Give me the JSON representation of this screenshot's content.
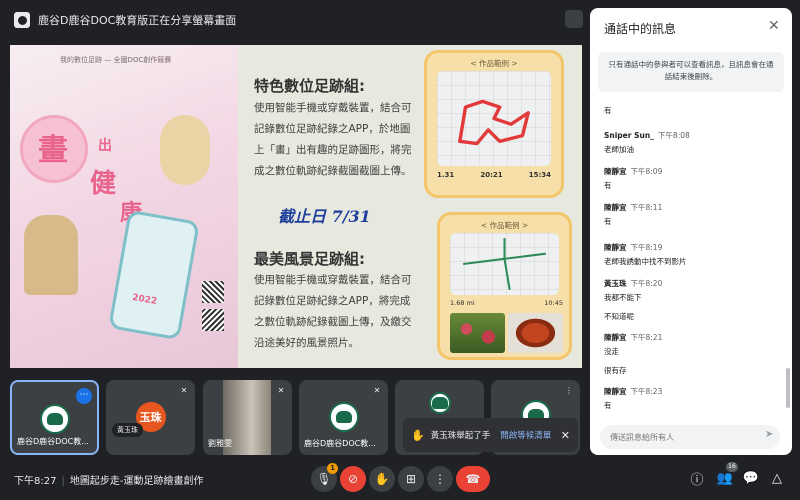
{
  "topbar": {
    "title": "鹿谷D鹿谷DOC教育版正在分享螢幕畫面"
  },
  "slide": {
    "poster": {
      "top_caption": "我的數位足跡 — 全國DOC創作競賽",
      "title_chars": [
        "畫",
        "出",
        "健",
        "康"
      ],
      "year": "2022"
    },
    "section1": {
      "title": "特色數位足跡組:",
      "body": "使用智能手機或穿戴裝置，結合可記錄數位足跡紀錄之APP，於地圖上「畫」出有趣的足跡圖形，將完成之數位軌跡紀錄截圖截圖上傳。"
    },
    "deadline": "截止日 7/31",
    "section2": {
      "title": "最美風景足跡組:",
      "body": "使用智能手機或穿戴裝置，結合可記錄數位足跡紀錄之APP，將完成之數位軌跡紀錄截圖上傳，及繳交沿途美好的風景照片。"
    },
    "example1": {
      "label": "< 作品範例 >",
      "stats": [
        "1.31",
        "20:21",
        "15:34"
      ]
    },
    "example2": {
      "label": "< 作品範例 >",
      "stats": [
        "1.68 mi",
        "10:45"
      ]
    }
  },
  "participants": [
    {
      "name": "鹿谷D鹿谷DOC教...",
      "avatar": "logo",
      "more": "⋯"
    },
    {
      "name": "黃玉珠",
      "avatar": "玉珠"
    },
    {
      "name": "劉雅雯",
      "avatar": "video"
    },
    {
      "name": "鹿谷D鹿谷DOC教...",
      "avatar": "logo"
    },
    {
      "name": "",
      "avatar": "logo"
    },
    {
      "name": "",
      "avatar": "logo"
    }
  ],
  "toast": {
    "text": "黃玉珠舉起了手",
    "link": "開啟等候清單"
  },
  "bottombar": {
    "time": "下午8:27",
    "meeting_title": "地圖起步走-運動足跡繪畫創作",
    "mic_badge": "1",
    "people_badge": "16"
  },
  "chat": {
    "title": "通話中的訊息",
    "notice": "只有通話中的參與者可以查看訊息，且訊息會在通話結束後刪除。",
    "input_placeholder": "傳送訊息給所有人",
    "messages": [
      {
        "sender": "",
        "time": "",
        "text": "有"
      },
      {
        "sender": "Sniper Sun_",
        "time": "下午8:08",
        "text": "老師加油"
      },
      {
        "sender": "陳靜宜",
        "time": "下午8:09",
        "text": "有"
      },
      {
        "sender": "陳靜宜",
        "time": "下午8:11",
        "text": "有"
      },
      {
        "sender": "陳靜宜",
        "time": "下午8:19",
        "text": "老師我誘動中找不到影片"
      },
      {
        "sender": "黃玉珠",
        "time": "下午8:20",
        "text": "我都不能下"
      },
      {
        "sender": "",
        "time": "",
        "text": "不知道呢"
      },
      {
        "sender": "陳靜宜",
        "time": "下午8:21",
        "text": "沒走"
      },
      {
        "sender": "",
        "time": "",
        "text": "很有存"
      },
      {
        "sender": "陳靜宜",
        "time": "下午8:23",
        "text": "有"
      }
    ]
  }
}
